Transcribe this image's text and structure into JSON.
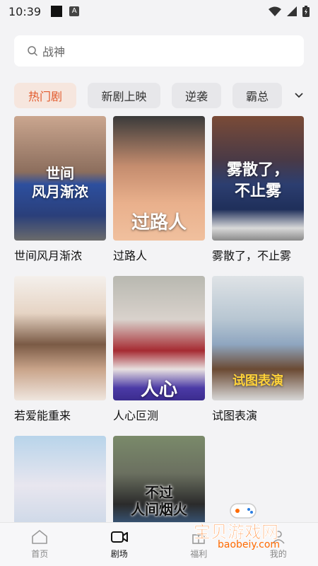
{
  "status_bar": {
    "time": "10:39",
    "a_badge": "A"
  },
  "search": {
    "placeholder": "战神"
  },
  "tabs": [
    {
      "label": "热门剧",
      "active": true
    },
    {
      "label": "新剧上映",
      "active": false
    },
    {
      "label": "逆袭",
      "active": false
    },
    {
      "label": "霸总",
      "active": false
    }
  ],
  "cards": [
    {
      "title": "世间风月渐浓",
      "poster_text": "世间\n风月渐浓"
    },
    {
      "title": "过路人",
      "poster_text": "过路人"
    },
    {
      "title": "雾散了，不止雾",
      "poster_text": "雾散了，\n不止雾"
    },
    {
      "title": "若爱能重来",
      "poster_text": ""
    },
    {
      "title": "人心叵测",
      "poster_text": "人心"
    },
    {
      "title": "试图表演",
      "poster_text": "试图表演"
    },
    {
      "title": "",
      "poster_text": ""
    },
    {
      "title": "",
      "poster_text": "不过\n人间烟火"
    }
  ],
  "bottom_nav": [
    {
      "label": "首页",
      "icon": "home-icon",
      "active": false
    },
    {
      "label": "剧场",
      "icon": "theater-icon",
      "active": true
    },
    {
      "label": "福利",
      "icon": "gift-icon",
      "active": false
    },
    {
      "label": "我的",
      "icon": "profile-icon",
      "active": false
    }
  ],
  "watermark": {
    "title": "宝贝游戏网",
    "url": "baobeiy.com"
  },
  "colors": {
    "accent": "#e25a2c",
    "active_tab_bg": "#f6e6de"
  }
}
